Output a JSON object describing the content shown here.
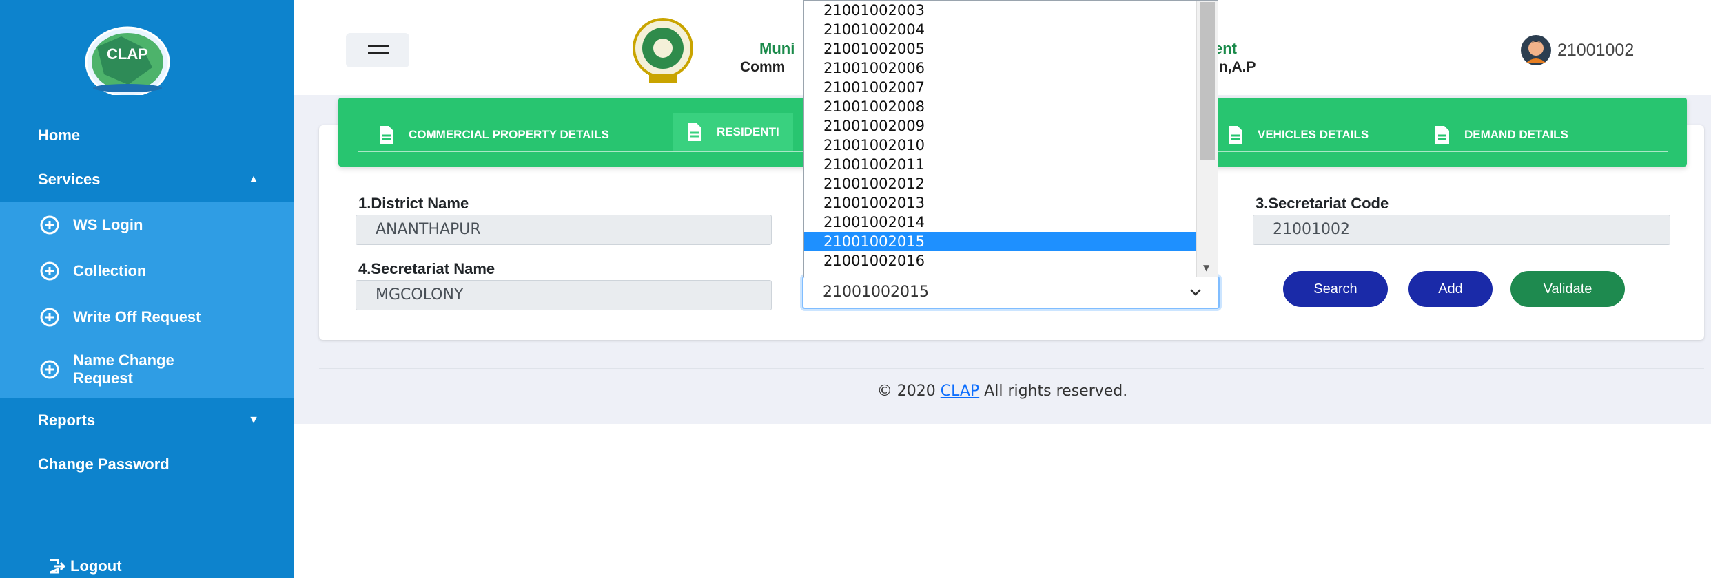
{
  "sidebar": {
    "logo_text": "CLAP",
    "items": [
      {
        "label": "Home"
      },
      {
        "label": "Services"
      },
      {
        "label": "Reports"
      },
      {
        "label": "Change Password"
      }
    ],
    "services_sub": [
      {
        "label": "WS Login"
      },
      {
        "label": "Collection"
      },
      {
        "label": "Write Off Request"
      },
      {
        "label": "Name Change Request"
      }
    ],
    "logout": "Logout"
  },
  "header": {
    "title_part1": "Muni",
    "title_part2": "ent",
    "subtitle_part1": "Comm",
    "subtitle_part2": "on,A.P",
    "user_id": "21001002"
  },
  "tabs": [
    {
      "label": "COMMERCIAL PROPERTY DETAILS"
    },
    {
      "label": "RESIDENTI"
    },
    {
      "label": "VEHICLES DETAILS"
    },
    {
      "label": "DEMAND DETAILS"
    }
  ],
  "form": {
    "district_label": "1.District Name",
    "district_value": "ANANTHAPUR",
    "sec_code_label": "3.Secretariat Code",
    "sec_code_value": "21001002",
    "sec_name_label": "4.Secretariat Name",
    "sec_name_value": "MGCOLONY",
    "select_value": "21001002015"
  },
  "buttons": {
    "search": "Search",
    "add": "Add",
    "validate": "Validate"
  },
  "dropdown": {
    "options": [
      "21001002003",
      "21001002004",
      "21001002005",
      "21001002006",
      "21001002007",
      "21001002008",
      "21001002009",
      "21001002010",
      "21001002011",
      "21001002012",
      "21001002013",
      "21001002014",
      "21001002015",
      "21001002016"
    ],
    "selected": "21001002015"
  },
  "footer": {
    "prefix": "© 2020 ",
    "link": "CLAP",
    "suffix": " All rights reserved."
  },
  "colors": {
    "sidebar": "#0d83cd",
    "submenu": "#2f9de4",
    "tabbar": "#28c570",
    "search_btn": "#1a2aa8",
    "add_btn": "#1a2aa8",
    "validate_btn": "#1e8a4f"
  }
}
